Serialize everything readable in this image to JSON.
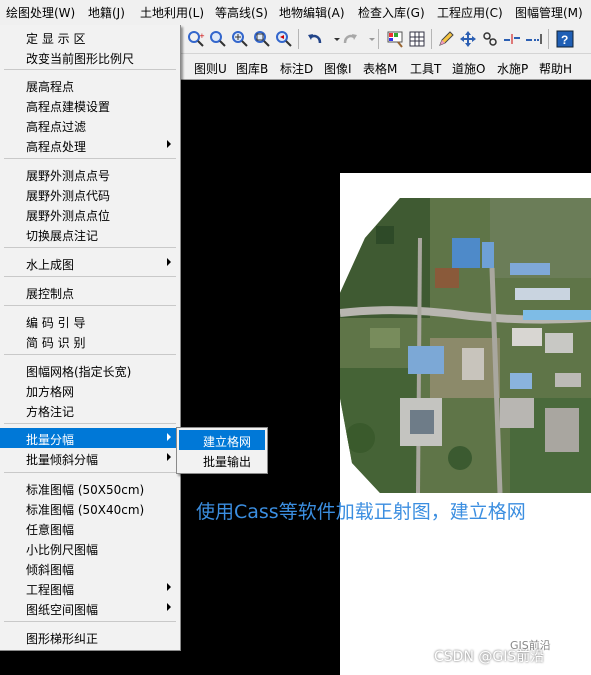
{
  "menubar": {
    "items": [
      "绘图处理(W)",
      "地籍(J)",
      "土地利用(L)",
      "等高线(S)",
      "地物编辑(A)",
      "检查入库(G)",
      "工程应用(C)",
      "图幅管理(M)"
    ]
  },
  "toolbar2": {
    "items": [
      "图则U",
      "图库B",
      "标注D",
      "图像I",
      "表格M",
      "工具T",
      "道施O",
      "水施P",
      "帮助H"
    ]
  },
  "menu": {
    "items": [
      {
        "label": "定 显 示 区"
      },
      {
        "label": "改变当前图形比例尺"
      },
      {
        "label": "展高程点"
      },
      {
        "label": "高程点建模设置"
      },
      {
        "label": "高程点过滤"
      },
      {
        "label": "高程点处理"
      },
      {
        "label": "展野外测点点号"
      },
      {
        "label": "展野外测点代码"
      },
      {
        "label": "展野外测点点位"
      },
      {
        "label": "切换展点注记"
      },
      {
        "label": "水上成图"
      },
      {
        "label": "展控制点"
      },
      {
        "label": "编 码 引 导"
      },
      {
        "label": "简 码 识 别"
      },
      {
        "label": "图幅网格(指定长宽)"
      },
      {
        "label": "加方格网"
      },
      {
        "label": "方格注记"
      },
      {
        "label": "批量分幅"
      },
      {
        "label": "批量倾斜分幅"
      },
      {
        "label": "标准图幅 (50X50cm)"
      },
      {
        "label": "标准图幅 (50X40cm)"
      },
      {
        "label": "任意图幅"
      },
      {
        "label": "小比例尺图幅"
      },
      {
        "label": "倾斜图幅"
      },
      {
        "label": "工程图幅"
      },
      {
        "label": "图纸空间图幅"
      },
      {
        "label": "图形梯形纠正"
      }
    ]
  },
  "submenu": {
    "items": [
      "建立格网",
      "批量输出"
    ]
  },
  "caption": "使用Cass等软件加载正射图，建立格网",
  "watermark": "CSDN @GIS前沿",
  "watermark_logo": "GIS前沿",
  "colors": {
    "highlight": "#0078d7",
    "caption": "#3b8ee0"
  }
}
